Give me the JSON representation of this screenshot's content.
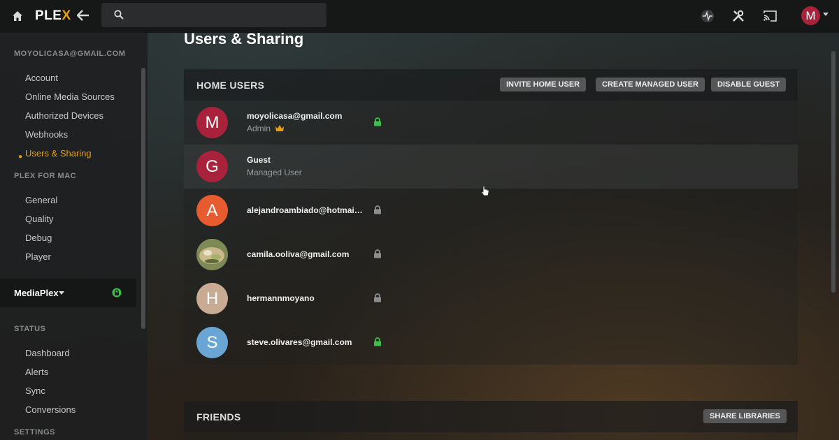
{
  "app": {
    "logo_text": "PLE",
    "logo_accent": "X",
    "brand_color": "#e5a00d"
  },
  "topbar": {
    "search_placeholder": "",
    "icons": [
      "home-icon",
      "back-arrow-icon",
      "search-icon",
      "activity-icon",
      "settings-tools-icon",
      "cast-icon"
    ],
    "avatar_letter": "M"
  },
  "sidebar": {
    "account_header": "MOYOLICASA@GMAIL.COM",
    "account_items": [
      "Account",
      "Online Media Sources",
      "Authorized Devices",
      "Webhooks",
      "Users & Sharing"
    ],
    "active_item": "Users & Sharing",
    "app_header": "PLEX FOR MAC",
    "app_items": [
      "General",
      "Quality",
      "Debug",
      "Player"
    ],
    "server_name": "MediaPlex",
    "status_header": "STATUS",
    "status_items": [
      "Dashboard",
      "Alerts",
      "Sync",
      "Conversions"
    ],
    "settings_header": "SETTINGS"
  },
  "main": {
    "title": "Users & Sharing",
    "home_users": {
      "header": "HOME USERS",
      "buttons": [
        "INVITE HOME USER",
        "CREATE MANAGED USER",
        "DISABLE GUEST"
      ],
      "users": [
        {
          "name": "moyolicasa@gmail.com",
          "role": "Admin",
          "avatar": "M",
          "avatar_color": "#a8223c",
          "lock": "green",
          "crown": true
        },
        {
          "name": "Guest",
          "role": "Managed User",
          "avatar": "G",
          "avatar_color": "#a8223c",
          "lock": "none",
          "crown": false
        },
        {
          "name": "alejandroambiado@hotmai…",
          "role": "",
          "avatar": "A",
          "avatar_color": "#e65c2f",
          "lock": "grey",
          "crown": false
        },
        {
          "name": "camila.ooliva@gmail.com",
          "role": "",
          "avatar": "",
          "avatar_color": "#6f7b4a",
          "lock": "grey",
          "crown": false
        },
        {
          "name": "hermannmoyano",
          "role": "",
          "avatar": "H",
          "avatar_color": "#c9ab93",
          "lock": "grey",
          "crown": false
        },
        {
          "name": "steve.olivares@gmail.com",
          "role": "",
          "avatar": "S",
          "avatar_color": "#6aa6d4",
          "lock": "green",
          "crown": false
        }
      ]
    },
    "friends": {
      "header": "FRIENDS",
      "button": "SHARE LIBRARIES"
    }
  },
  "colors": {
    "lock_green": "#3cbf4a",
    "lock_grey": "#8b8d8e",
    "crown_gold": "#e5a00d"
  }
}
